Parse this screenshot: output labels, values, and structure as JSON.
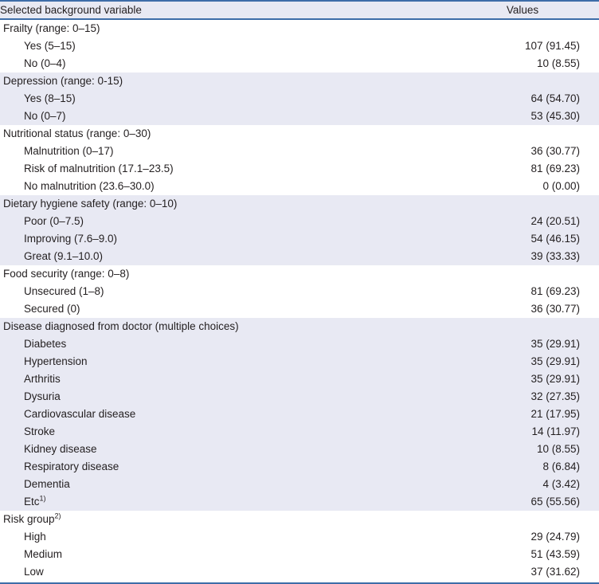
{
  "table": {
    "columns": [
      {
        "key": "label",
        "header": "Selected background variable",
        "align": "left"
      },
      {
        "key": "value",
        "header": "Values",
        "align": "center"
      }
    ],
    "colors": {
      "rule": "#3e6da8",
      "shaded_row": "#e8e9f3",
      "plain_row": "#ffffff",
      "text": "#231f20"
    },
    "sections": [
      {
        "shaded": false,
        "group": "Frailty (range: 0–15)",
        "rows": [
          {
            "label": "Yes (5–15)",
            "value": "107 (91.45)"
          },
          {
            "label": "No (0–4)",
            "value": "10 (8.55)"
          }
        ]
      },
      {
        "shaded": true,
        "group": "Depression (range: 0-15)",
        "rows": [
          {
            "label": "Yes (8–15)",
            "value": "64 (54.70)"
          },
          {
            "label": "No (0–7)",
            "value": "53 (45.30)"
          }
        ]
      },
      {
        "shaded": false,
        "group": "Nutritional status (range: 0–30)",
        "rows": [
          {
            "label": "Malnutrition (0–17)",
            "value": "36 (30.77)"
          },
          {
            "label": "Risk of malnutrition (17.1–23.5)",
            "value": "81 (69.23)"
          },
          {
            "label": "No malnutrition (23.6–30.0)",
            "value": "0 (0.00)"
          }
        ]
      },
      {
        "shaded": true,
        "group": "Dietary hygiene safety (range: 0–10)",
        "rows": [
          {
            "label": "Poor (0–7.5)",
            "value": "24 (20.51)"
          },
          {
            "label": "Improving (7.6–9.0)",
            "value": "54 (46.15)"
          },
          {
            "label": "Great (9.1–10.0)",
            "value": "39 (33.33)"
          }
        ]
      },
      {
        "shaded": false,
        "group": "Food security (range: 0–8)",
        "rows": [
          {
            "label": "Unsecured (1–8)",
            "value": "81 (69.23)"
          },
          {
            "label": "Secured (0)",
            "value": "36 (30.77)"
          }
        ]
      },
      {
        "shaded": true,
        "group": "Disease diagnosed from doctor (multiple choices)",
        "rows": [
          {
            "label": "Diabetes",
            "value": "35 (29.91)"
          },
          {
            "label": "Hypertension",
            "value": "35 (29.91)"
          },
          {
            "label": "Arthritis",
            "value": "35 (29.91)"
          },
          {
            "label": "Dysuria",
            "value": "32 (27.35)"
          },
          {
            "label": "Cardiovascular disease",
            "value": "21 (17.95)"
          },
          {
            "label": "Stroke",
            "value": "14 (11.97)"
          },
          {
            "label": "Kidney disease",
            "value": "10 (8.55)"
          },
          {
            "label": "Respiratory disease",
            "value": "8 (6.84)"
          },
          {
            "label": "Dementia",
            "value": "4 (3.42)"
          },
          {
            "label": "Etc",
            "sup": "1)",
            "value": "65 (55.56)"
          }
        ]
      },
      {
        "shaded": false,
        "group": "Risk group",
        "group_sup": "2)",
        "rows": [
          {
            "label": "High",
            "value": "29 (24.79)"
          },
          {
            "label": "Medium",
            "value": "51 (43.59)"
          },
          {
            "label": "Low",
            "value": "37 (31.62)"
          }
        ]
      }
    ]
  }
}
